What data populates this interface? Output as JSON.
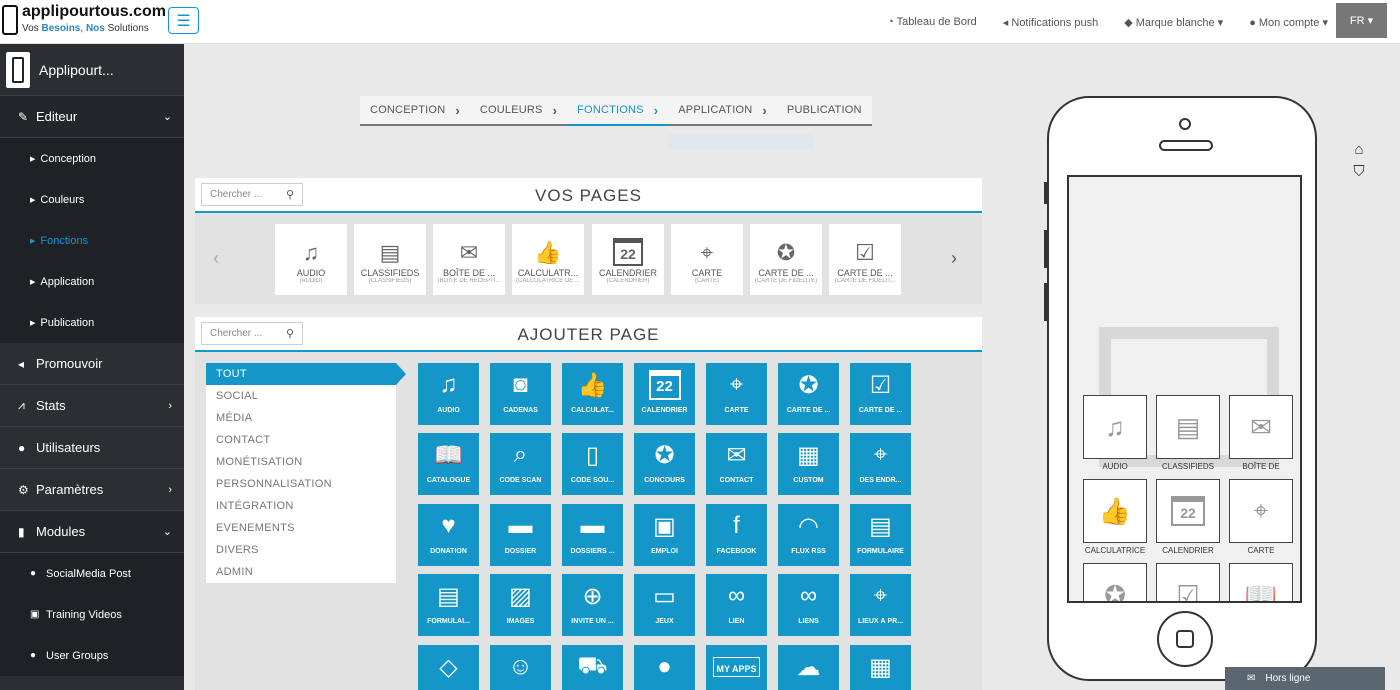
{
  "header": {
    "logo_title": "applipourtous.com",
    "logo_tag_a": "Vos ",
    "logo_tag_b": "Besoins",
    "logo_tag_c": ", ",
    "logo_tag_d": "Nos",
    "logo_tag_e": " Solutions",
    "nav": [
      "Tableau de Bord",
      "Notifications push",
      "Marque blanche ▾",
      "Mon compte ▾"
    ],
    "lang": "FR ▾"
  },
  "sidebar": {
    "app_name": "Applipourt...",
    "editeur": "Editeur",
    "editeur_subs": [
      "Conception",
      "Couleurs",
      "Fonctions",
      "Application",
      "Publication"
    ],
    "promouvoir": "Promouvoir",
    "stats": "Stats",
    "utilisateurs": "Utilisateurs",
    "parametres": "Paramètres",
    "modules": "Modules",
    "modules_subs": [
      "SocialMedia Post",
      "Training Videos",
      "User Groups"
    ]
  },
  "steps": [
    "CONCEPTION",
    "COULEURS",
    "FONCTIONS",
    "APPLICATION",
    "PUBLICATION"
  ],
  "vos_pages": {
    "search_placeholder": "Chercher ...",
    "title": "VOS PAGES",
    "cards": [
      {
        "name": "AUDIO",
        "sub": "(AUDIO)"
      },
      {
        "name": "CLASSIFIEDS",
        "sub": "(CLASSIFIEDS)"
      },
      {
        "name": "BOÎTE DE ...",
        "sub": "(BOITE DE RECEPTI..."
      },
      {
        "name": "CALCULATR...",
        "sub": "(CALCULATRICE DE ..."
      },
      {
        "name": "CALENDRIER",
        "sub": "(CALENDRIER)"
      },
      {
        "name": "CARTE",
        "sub": "(CARTE)"
      },
      {
        "name": "CARTE DE ...",
        "sub": "(CARTE DE FIDELITE)"
      },
      {
        "name": "CARTE DE ...",
        "sub": "(CARTE DE FIDELIT..."
      }
    ]
  },
  "ajouter_page": {
    "search_placeholder": "Chercher ...",
    "title": "AJOUTER PAGE",
    "categories": [
      "TOUT",
      "SOCIAL",
      "MÉDIA",
      "CONTACT",
      "MONÉTISATION",
      "PERSONNALISATION",
      "INTÉGRATION",
      "EVENEMENTS",
      "DIVERS",
      "ADMIN"
    ],
    "tiles": [
      "AUDIO",
      "CADENAS",
      "CALCULAT...",
      "CALENDRIER",
      "CARTE",
      "CARTE DE ...",
      "CARTE DE ...",
      "CATALOGUE",
      "CODE SCAN",
      "CODE SOU...",
      "CONCOURS",
      "CONTACT",
      "CUSTOM",
      "DES ENDR...",
      "DONATION",
      "DOSSIER",
      "DOSSIERS ...",
      "EMPLOI",
      "FACEBOOK",
      "FLUX RSS",
      "FORMULAIRE",
      "FORMULAI...",
      "IMAGES",
      "INVITE UN ...",
      "JEUX",
      "LIEN",
      "LIENS",
      "LIEUX À PR...",
      "",
      "",
      "",
      "",
      "",
      "",
      ""
    ],
    "tile_icon_texts": {
      "calendar": "22",
      "myapps": "MY APPS"
    }
  },
  "preview": {
    "tiles": [
      "AUDIO",
      "CLASSIFIEDS",
      "BOÎTE DE",
      "CALCULATRICE",
      "CALENDRIER",
      "CARTE"
    ],
    "calendar_number": "22"
  },
  "status": {
    "offline": "Hors ligne"
  }
}
